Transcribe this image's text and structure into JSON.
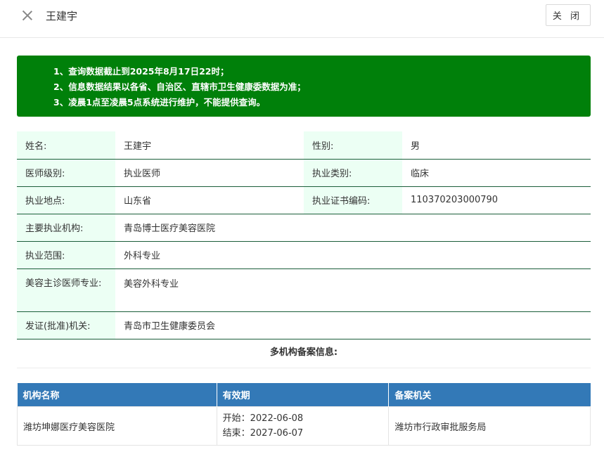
{
  "header": {
    "title": "王建宇",
    "close_label": "关 闭"
  },
  "notice": {
    "lines": [
      "1、查询数据截止到2025年8月17日22时；",
      "2、信息数据结果以各省、自治区、直辖市卫生健康委数据为准；",
      "3、凌晨1点至凌晨5点系统进行维护，不能提供查询。"
    ],
    "color": "#00800a"
  },
  "info": {
    "name_label": "姓名:",
    "name_value": "王建宇",
    "gender_label": "性别:",
    "gender_value": "男",
    "level_label": "医师级别:",
    "level_value": "执业医师",
    "category_label": "执业类别:",
    "category_value": "临床",
    "location_label": "执业地点:",
    "location_value": "山东省",
    "cert_label": "执业证书编码:",
    "cert_value": "110370203000790",
    "org_label": "主要执业机构:",
    "org_value": "青岛博士医疗美容医院",
    "scope_label": "执业范围:",
    "scope_value": "外科专业",
    "cosmetic_label": "美容主诊医师专业:",
    "cosmetic_value": "美容外科专业",
    "issuer_label": "发证(批准)机关:",
    "issuer_value": "青岛市卫生健康委员会"
  },
  "multi": {
    "title": "多机构备案信息:",
    "columns": [
      "机构名称",
      "有效期",
      "备案机关"
    ],
    "rows": [
      {
        "org": "潍坊坤娜医疗美容医院",
        "start": "开始：2022-06-08",
        "end": "结束：2027-06-07",
        "authority": "潍坊市行政审批服务局"
      }
    ]
  }
}
